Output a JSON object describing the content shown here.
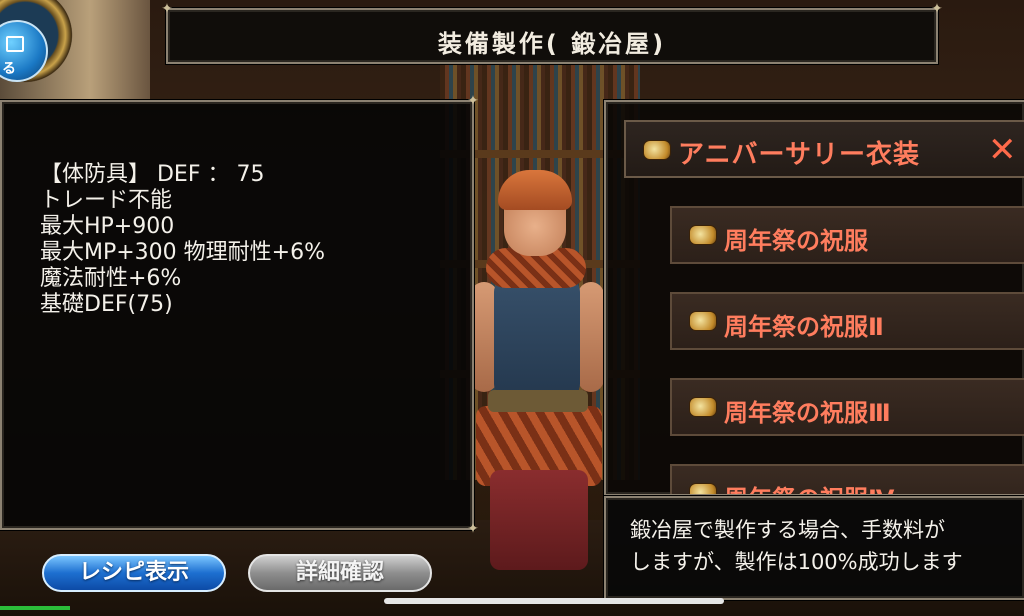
{
  "header": {
    "title": "装備製作( 鍛冶屋)"
  },
  "menu": {
    "label": "る"
  },
  "item_info": {
    "lines": [
      "【体防具】 DEF ： 75",
      "トレード不能",
      "最大HP+900",
      "最大MP+300 物理耐性+6%",
      "魔法耐性+6%",
      "基礎DEF(75)"
    ]
  },
  "recipe_list": {
    "category": "アニバーサリー衣装",
    "close_label": "✕",
    "items": [
      {
        "label": "周年祭の祝服"
      },
      {
        "label": "周年祭の祝服Ⅱ"
      },
      {
        "label": "周年祭の祝服Ⅲ"
      },
      {
        "label": "周年祭の祝服Ⅳ"
      }
    ]
  },
  "message": {
    "line1": "鍛冶屋で製作する場合、手数料が",
    "line2": "しますが、製作は100%成功します"
  },
  "buttons": {
    "recipe": "レシピ表示",
    "detail": "詳細確認"
  },
  "colors": {
    "recipe_text": "#ff7d5e",
    "primary_button": "#1d6fd0",
    "secondary_button": "#8e8e8e"
  }
}
